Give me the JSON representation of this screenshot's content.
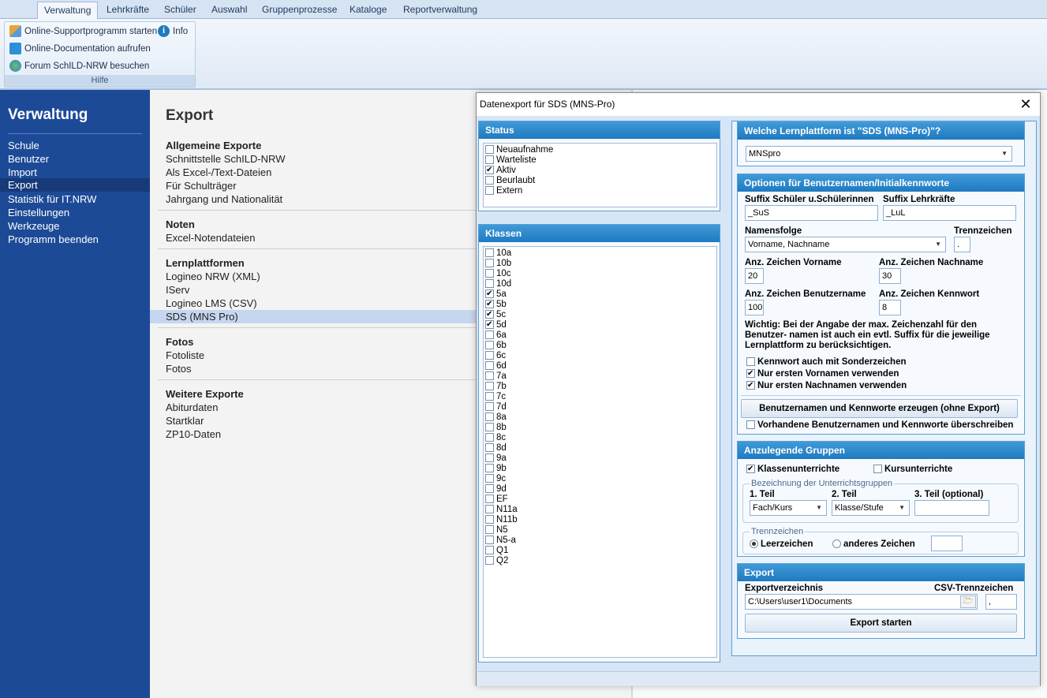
{
  "ribbon": {
    "tabs": [
      "Verwaltung",
      "Lehrkräfte",
      "Schüler",
      "Auswahl",
      "Gruppenprozesse",
      "Kataloge",
      "Reportverwaltung"
    ],
    "group_label": "Hilfe",
    "buttons": {
      "support": "Online-Supportprogramm starten",
      "info": "Info",
      "doc": "Online-Documentation aufrufen",
      "forum": "Forum SchILD-NRW besuchen"
    }
  },
  "leftnav": {
    "title": "Verwaltung",
    "items": [
      "Schule",
      "Benutzer",
      "Import",
      "Export",
      "Statistik für IT.NRW",
      "Einstellungen",
      "Werkzeuge",
      "Programm beenden"
    ]
  },
  "main": {
    "title": "Export",
    "sections": [
      {
        "heading": "Allgemeine Exporte",
        "items": [
          "Schnittstelle SchILD-NRW",
          "Als Excel-/Text-Dateien",
          "Für Schulträger",
          "Jahrgang und Nationalität"
        ]
      },
      {
        "heading": "Noten",
        "items": [
          "Excel-Notendateien"
        ]
      },
      {
        "heading": "Lernplattformen",
        "items": [
          "Logineo NRW (XML)",
          "IServ",
          "Logineo LMS (CSV)",
          "SDS (MNS Pro)"
        ]
      },
      {
        "heading": "Fotos",
        "items": [
          "Fotoliste",
          "Fotos"
        ]
      },
      {
        "heading": "Weitere Exporte",
        "items": [
          "Abiturdaten",
          "Startklar",
          "ZP10-Daten"
        ]
      }
    ]
  },
  "dialog": {
    "title": "Datenexport für SDS (MNS-Pro)",
    "close": "✕",
    "status": {
      "header": "Status",
      "items": [
        {
          "label": "Neuaufnahme",
          "checked": false
        },
        {
          "label": "Warteliste",
          "checked": false
        },
        {
          "label": "Aktiv",
          "checked": true
        },
        {
          "label": "Beurlaubt",
          "checked": false
        },
        {
          "label": "Extern",
          "checked": false
        }
      ]
    },
    "klassen": {
      "header": "Klassen",
      "items": [
        {
          "label": "10a",
          "checked": false
        },
        {
          "label": "10b",
          "checked": false
        },
        {
          "label": "10c",
          "checked": false
        },
        {
          "label": "10d",
          "checked": false
        },
        {
          "label": "5a",
          "checked": true
        },
        {
          "label": "5b",
          "checked": true
        },
        {
          "label": "5c",
          "checked": true
        },
        {
          "label": "5d",
          "checked": true
        },
        {
          "label": "6a",
          "checked": false
        },
        {
          "label": "6b",
          "checked": false
        },
        {
          "label": "6c",
          "checked": false
        },
        {
          "label": "6d",
          "checked": false
        },
        {
          "label": "7a",
          "checked": false
        },
        {
          "label": "7b",
          "checked": false
        },
        {
          "label": "7c",
          "checked": false
        },
        {
          "label": "7d",
          "checked": false
        },
        {
          "label": "8a",
          "checked": false
        },
        {
          "label": "8b",
          "checked": false
        },
        {
          "label": "8c",
          "checked": false
        },
        {
          "label": "8d",
          "checked": false
        },
        {
          "label": "9a",
          "checked": false
        },
        {
          "label": "9b",
          "checked": false
        },
        {
          "label": "9c",
          "checked": false
        },
        {
          "label": "9d",
          "checked": false
        },
        {
          "label": "EF",
          "checked": false
        },
        {
          "label": "N11a",
          "checked": false
        },
        {
          "label": "N11b",
          "checked": false
        },
        {
          "label": "N5",
          "checked": false
        },
        {
          "label": "N5-a",
          "checked": false
        },
        {
          "label": "Q1",
          "checked": false
        },
        {
          "label": "Q2",
          "checked": false
        }
      ]
    },
    "platform": {
      "header": "Welche Lernplattform ist \"SDS (MNS-Pro)\"?",
      "value": "MNSpro"
    },
    "options": {
      "header": "Optionen für Benutzernamen/Initialkennworte",
      "suffix_sus_label": "Suffix Schüler u.Schülerinnen",
      "suffix_sus_value": "_SuS",
      "suffix_lul_label": "Suffix Lehrkräfte",
      "suffix_lul_value": "_LuL",
      "namensfolge_label": "Namensfolge",
      "namensfolge_value": "Vorname, Nachname",
      "trennzeichen_label": "Trennzeichen",
      "trennzeichen_value": ".",
      "vorname_label": "Anz. Zeichen Vorname",
      "vorname_value": "20",
      "nachname_label": "Anz. Zeichen Nachname",
      "nachname_value": "30",
      "benutzername_label": "Anz. Zeichen Benutzername",
      "benutzername_value": "100",
      "kennwort_label": "Anz. Zeichen Kennwort",
      "kennwort_value": "8",
      "hint_line1": "Wichtig: Bei der Angabe der max. Zeichenzahl für den",
      "hint_line2": "Benutzer- namen ist auch ein evtl. Suffix für die jeweilige",
      "hint_line3": "Lernplattform zu berücksichtigen.",
      "cb_sonderzeichen": "Kennwort auch mit Sonderzeichen",
      "cb_vorname": "Nur ersten Vornamen verwenden",
      "cb_nachname": "Nur ersten Nachnamen verwenden",
      "generate_button": "Benutzernamen und Kennworte erzeugen (ohne Export)",
      "cb_overwrite": "Vorhandene Benutzernamen und Kennworte überschreiben"
    },
    "gruppen": {
      "header": "Anzulegende Gruppen",
      "cb_klassen": "Klassenunterrichte",
      "cb_kurs": "Kursunterrichte",
      "bez_title": "Bezeichnung der Unterrichtsgruppen",
      "teil1_label": "1. Teil",
      "teil1_value": "Fach/Kurs",
      "teil2_label": "2. Teil",
      "teil2_value": "Klasse/Stufe",
      "teil3_label": "3. Teil (optional)",
      "trenn_title": "Trennzeichen",
      "radio_leer": "Leerzeichen",
      "radio_anderes": "anderes Zeichen"
    },
    "export": {
      "header": "Export",
      "dir_label": "Exportverzeichnis",
      "dir_value": "C:\\Users\\user1\\Documents",
      "csv_label": "CSV-Trennzeichen",
      "csv_value": ",",
      "start_button": "Export starten"
    }
  }
}
